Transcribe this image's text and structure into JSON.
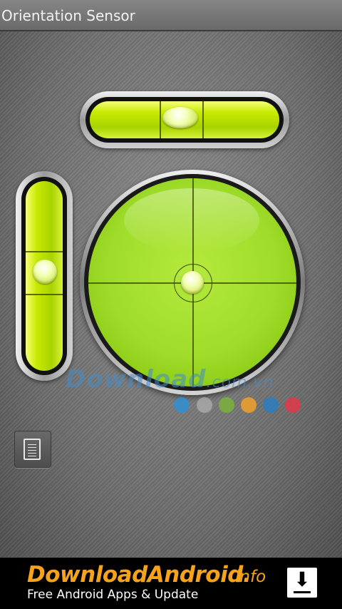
{
  "app": {
    "title": "Orientation Sensor"
  },
  "watermark": {
    "text": "Download",
    "suffix": ".com.vn"
  },
  "watermark_dots": [
    "#2f8fd0",
    "#a8a8a8",
    "#7ab23a",
    "#f2a12a",
    "#2a7dc0",
    "#e23a4a"
  ],
  "menu": {
    "icon": "document-icon"
  },
  "banner": {
    "brand": "DownloadAndroid",
    "brand_dot": ".",
    "brand_suffix": "info",
    "tagline": "Free Android Apps & Update",
    "action_icon": "download-icon"
  },
  "colors": {
    "liquid": "#b8e000",
    "brand": "#f7a21b"
  }
}
